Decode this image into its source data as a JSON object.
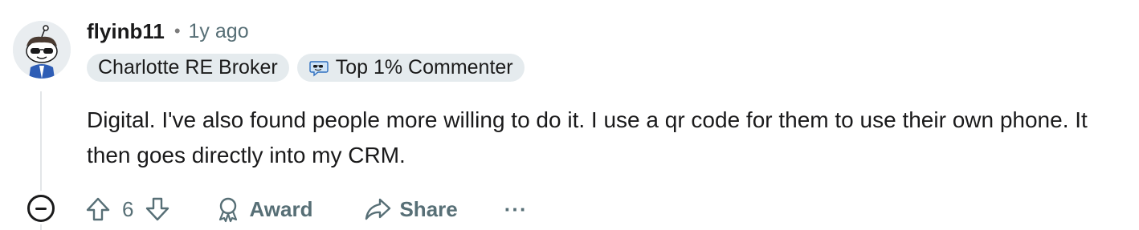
{
  "comment": {
    "author": "flyinb11",
    "separator": "•",
    "time_ago": "1y ago",
    "flairs": [
      {
        "label": "Charlotte RE Broker"
      },
      {
        "label": "Top 1% Commenter",
        "icon": "commenter-badge-icon"
      }
    ],
    "body": "Digital. I've also found people more willing to do it. I use a qr code for them to use their own phone. It then goes directly into my CRM.",
    "actions": {
      "score": "6",
      "award_label": "Award",
      "share_label": "Share",
      "more_label": "···"
    }
  },
  "colors": {
    "meta_gray": "#576f76",
    "flair_bg": "#e5ebee",
    "thread_line": "#e3e6e8",
    "text": "#1a1a1b"
  },
  "icons": [
    "avatar",
    "collapse-icon",
    "upvote-icon",
    "downvote-icon",
    "award-icon",
    "share-icon",
    "more-options-icon"
  ]
}
